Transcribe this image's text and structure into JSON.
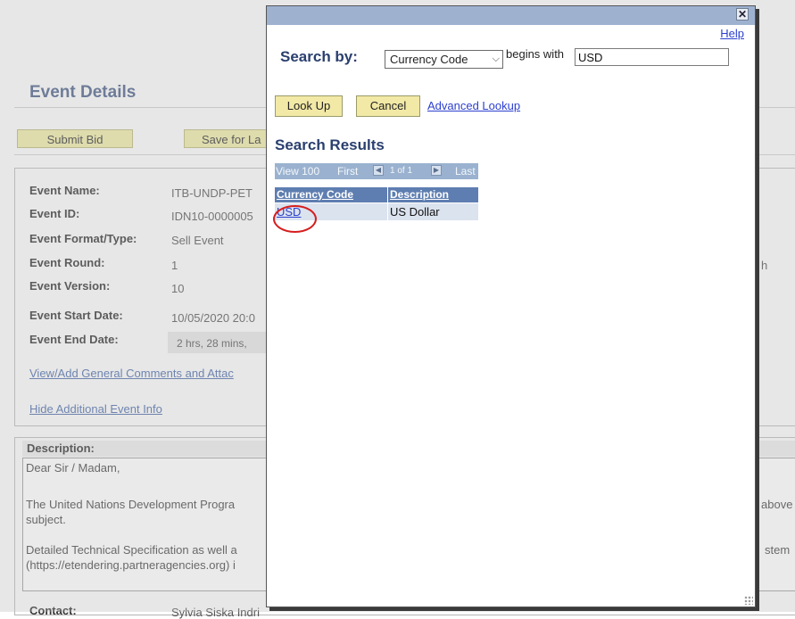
{
  "background": {
    "page_title": "Event Details",
    "buttons": {
      "submit_bid": "Submit Bid",
      "save_for_later": "Save for La"
    },
    "fields": [
      {
        "label": "Event Name:",
        "value": "ITB-UNDP-PET"
      },
      {
        "label": "Event ID:",
        "value": "IDN10-0000005"
      },
      {
        "label": "Event Format/Type:",
        "value": "Sell Event"
      },
      {
        "label": "Event Round:",
        "value": "1"
      },
      {
        "label": "Event Version:",
        "value": "10"
      },
      {
        "label": "Event Start Date:",
        "value": "10/05/2020 20:0"
      },
      {
        "label": "Event End Date:",
        "value": "2 hrs, 28 mins,"
      }
    ],
    "right_fragment": "h",
    "links": {
      "comments": "View/Add General Comments and Attac",
      "hide_info": "Hide Additional Event Info"
    },
    "description": {
      "header": "Description:",
      "lines": [
        "Dear Sir / Madam,",
        "The United Nations Development Progra",
        "subject.",
        "Detailed Technical Specification as well a",
        "(https://etendering.partneragencies.org) i"
      ],
      "right_fragments": [
        "above",
        "stem"
      ]
    },
    "contact": {
      "label": "Contact:",
      "value": "Sylvia Siska Indri"
    }
  },
  "modal": {
    "close_symbol": "✕",
    "help_label": "Help",
    "search_by_label": "Search by:",
    "search_field": {
      "selected": "Currency Code",
      "chevron": "⌵"
    },
    "operator_label": "begins with",
    "search_value": "USD",
    "buttons": {
      "look_up": "Look Up",
      "cancel": "Cancel",
      "advanced": "Advanced Lookup"
    },
    "results_title": "Search Results",
    "nav": {
      "view_all": "View 100",
      "first": "First",
      "range": "1 of 1",
      "last": "Last",
      "prev_glyph": "◀",
      "next_glyph": "▶"
    },
    "columns": [
      "Currency Code",
      "Description"
    ],
    "rows": [
      {
        "code": "USD",
        "description": "US Dollar"
      }
    ]
  }
}
